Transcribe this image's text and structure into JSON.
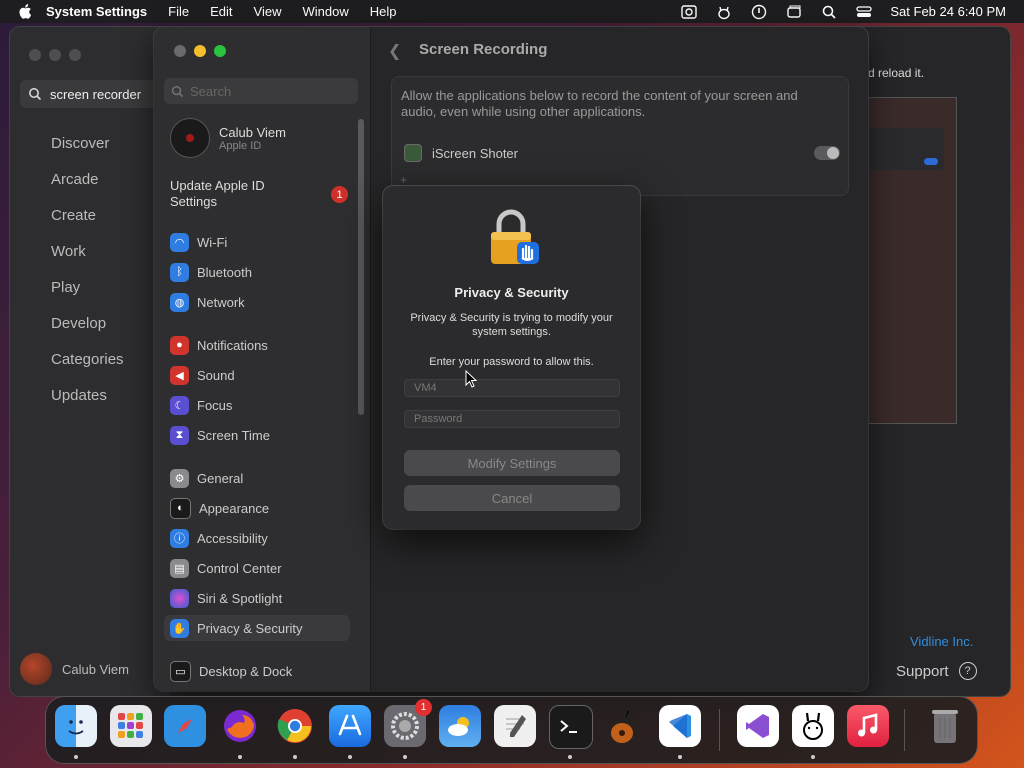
{
  "menubar": {
    "app_name": "System Settings",
    "menus": [
      "File",
      "Edit",
      "View",
      "Window",
      "Help"
    ],
    "clock": "Sat Feb 24  6:40 PM"
  },
  "appstore": {
    "search_query": "screen recorder",
    "nav": [
      "Discover",
      "Arcade",
      "Create",
      "Work",
      "Play",
      "Develop",
      "Categories",
      "Updates"
    ],
    "user_name": "Calub Viem",
    "reload_text": "d reload it.",
    "vendor_link": "Vidline Inc.",
    "support_label": "Support"
  },
  "settings": {
    "search_placeholder": "Search",
    "profile": {
      "name": "Calub Viem",
      "subtitle": "Apple ID"
    },
    "update": {
      "label": "Update Apple ID Settings",
      "badge": "1"
    },
    "sidebar": [
      {
        "label": "Wi-Fi",
        "icon": "wifi-icon",
        "color": "#2f7de0"
      },
      {
        "label": "Bluetooth",
        "icon": "bluetooth-icon",
        "color": "#2f7de0"
      },
      {
        "label": "Network",
        "icon": "network-icon",
        "color": "#2f7de0"
      },
      {
        "label": "Notifications",
        "icon": "bell-icon",
        "color": "#d0342c"
      },
      {
        "label": "Sound",
        "icon": "speaker-icon",
        "color": "#d0342c"
      },
      {
        "label": "Focus",
        "icon": "moon-icon",
        "color": "#5a4fd0"
      },
      {
        "label": "Screen Time",
        "icon": "hourglass-icon",
        "color": "#5a4fd0"
      },
      {
        "label": "General",
        "icon": "gear-icon",
        "color": "#8a8a8e"
      },
      {
        "label": "Appearance",
        "icon": "appearance-icon",
        "color": "#1a1a1a"
      },
      {
        "label": "Accessibility",
        "icon": "accessibility-icon",
        "color": "#2f7de0"
      },
      {
        "label": "Control Center",
        "icon": "control-center-icon",
        "color": "#8a8a8e"
      },
      {
        "label": "Siri & Spotlight",
        "icon": "siri-icon",
        "color": "#c04fd0"
      },
      {
        "label": "Privacy & Security",
        "icon": "hand-icon",
        "color": "#2f7de0"
      },
      {
        "label": "Desktop & Dock",
        "icon": "dock-icon",
        "color": "#1a1a1a"
      }
    ],
    "main": {
      "title": "Screen Recording",
      "description": "Allow the applications below to record the content of your screen and audio, even while using other applications.",
      "app_label": "iScreen Shoter"
    }
  },
  "dialog": {
    "title": "Privacy & Security",
    "message": "Privacy & Security is trying to modify your system settings.",
    "prompt": "Enter your password to allow this.",
    "username_value": "VM4",
    "password_placeholder": "Password",
    "modify_label": "Modify Settings",
    "cancel_label": "Cancel"
  },
  "dock": {
    "apps": [
      "finder-icon",
      "launchpad-icon",
      "safari-icon",
      "firefox-icon",
      "chrome-icon",
      "app-store-icon",
      "system-settings-icon",
      "weather-icon",
      "textedit-icon",
      "terminal-icon",
      "garageband-icon",
      "vscode-icon",
      "visual-studio-icon",
      "ollama-icon",
      "music-icon",
      "trash-icon"
    ],
    "settings_badge": "1"
  }
}
